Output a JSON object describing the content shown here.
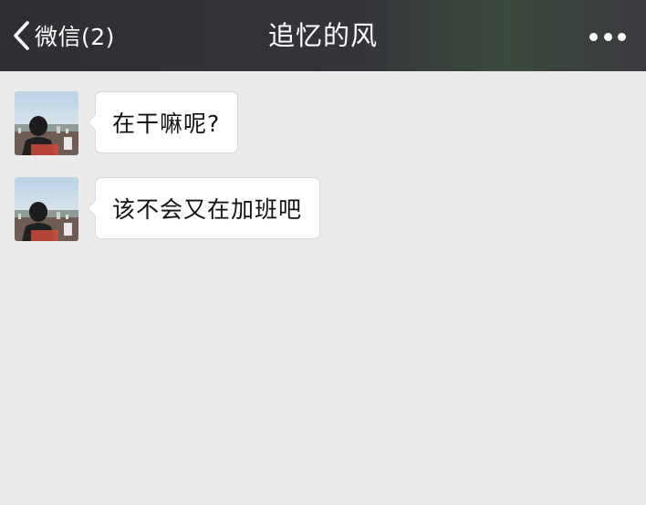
{
  "header": {
    "back_label": "微信(2)",
    "title": "追忆的风",
    "back_icon": "chevron-left-icon",
    "more_icon": "more-dots-icon"
  },
  "messages": [
    {
      "sender": "contact",
      "avatar": "contact-avatar",
      "text": "在干嘛呢?"
    },
    {
      "sender": "contact",
      "avatar": "contact-avatar",
      "text": "该不会又在加班吧"
    }
  ],
  "colors": {
    "nav_background": "#2f2e33",
    "chat_background": "#ebebeb",
    "bubble_background": "#ffffff",
    "nav_text": "#ffffff"
  }
}
